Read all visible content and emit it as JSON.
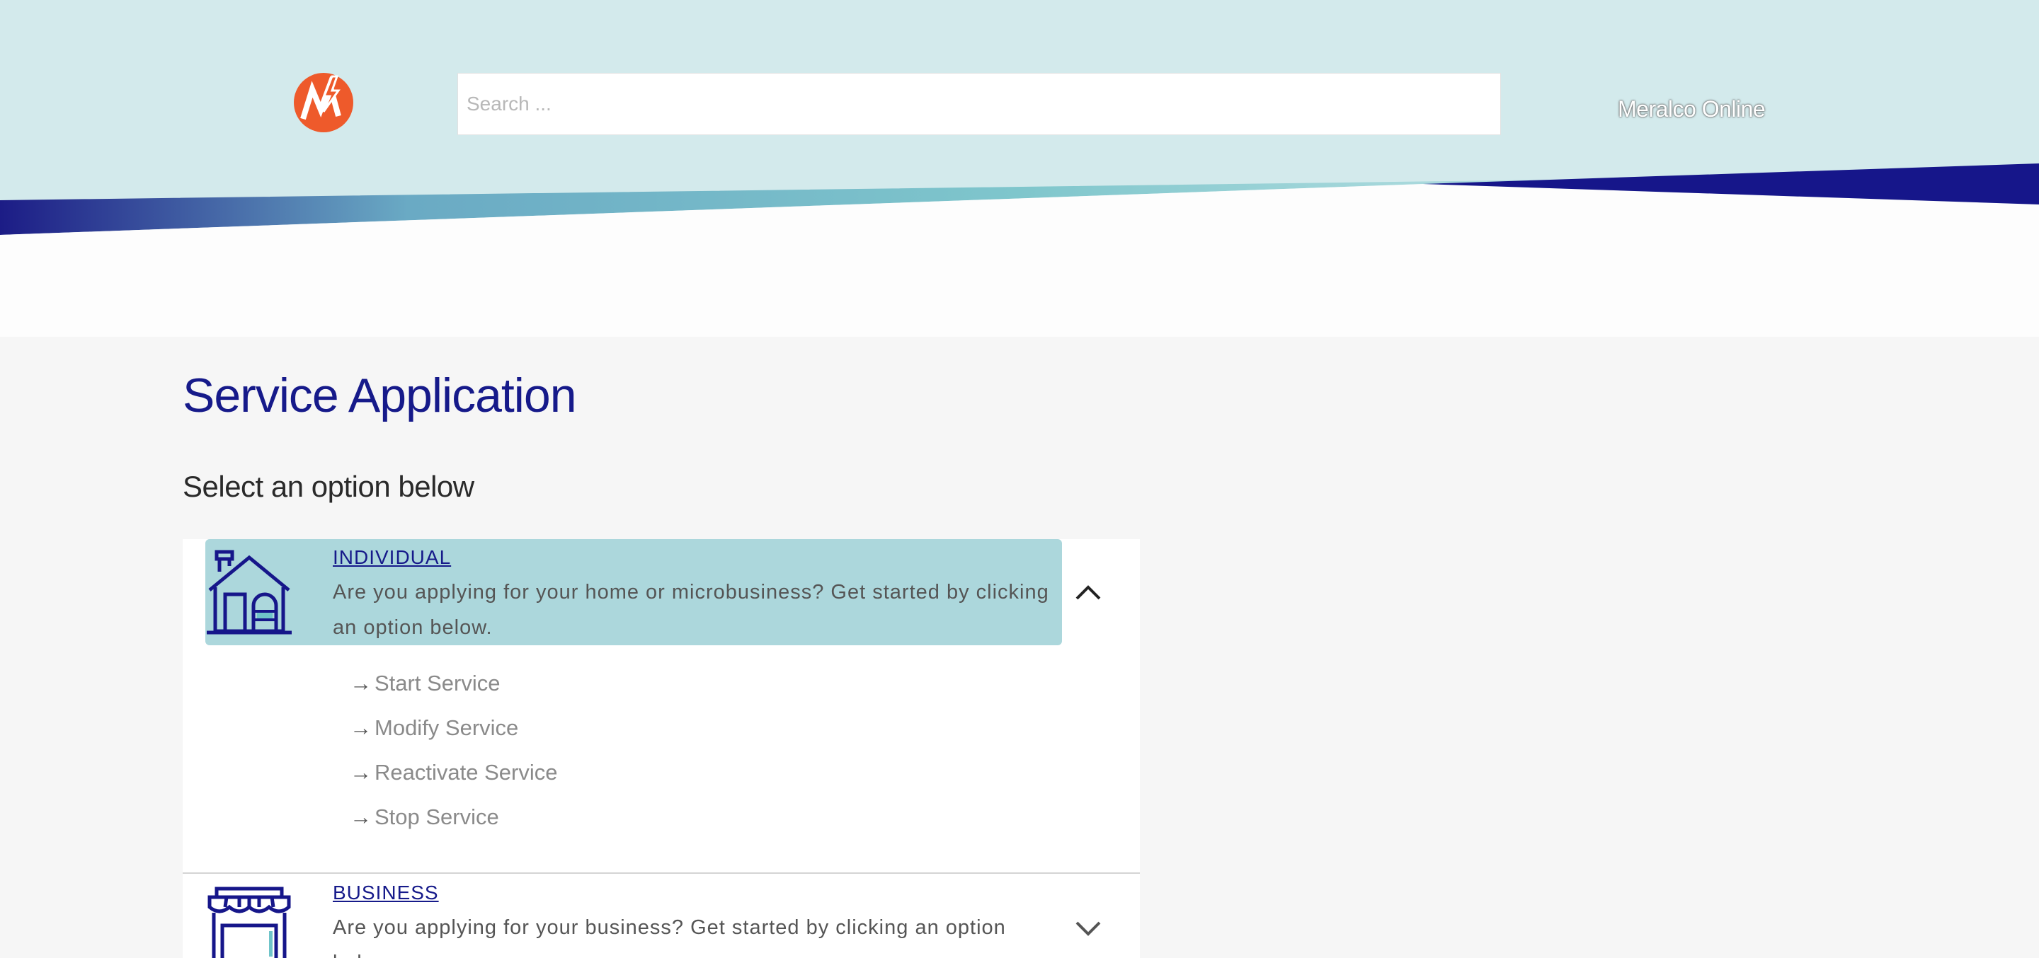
{
  "header": {
    "search_placeholder": "Search ...",
    "online_link": "Meralco Online",
    "colors": {
      "logo": "#ee5a2b",
      "band": "#d3eaec",
      "accent_navy": "#16168a",
      "teal": "#6fc4c9"
    }
  },
  "main": {
    "title": "Service Application",
    "subtitle": "Select an option below"
  },
  "categories": [
    {
      "title": "INDIVIDUAL",
      "description": "Are you applying for your home or microbusiness? Get started by clicking an option below.",
      "expanded": true,
      "icon": "house-icon",
      "links": [
        "Start Service",
        "Modify Service",
        "Reactivate Service",
        "Stop Service"
      ]
    },
    {
      "title": "BUSINESS",
      "description": "Are you applying for your business? Get started by clicking an option below.",
      "expanded": false,
      "icon": "storefront-icon"
    }
  ],
  "icons": {
    "link_arrow": "→",
    "collapse": "chevron-up-icon",
    "expand": "chevron-down-icon"
  }
}
